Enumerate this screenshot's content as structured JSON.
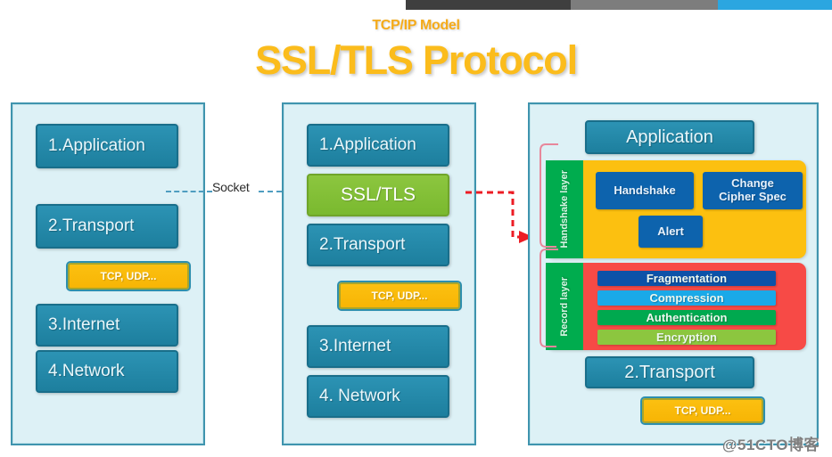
{
  "topbar": {
    "segments": [
      {
        "name": "dark",
        "color": "#3f3f3f"
      },
      {
        "name": "gray",
        "color": "#7d7d7d"
      },
      {
        "name": "blue",
        "color": "#2ba6e0"
      }
    ]
  },
  "header": {
    "subtitle": "TCP/IP Model",
    "title": "SSL/TLS Protocol",
    "title_color": "#fbbc1c",
    "subtitle_color": "#f5ab1a"
  },
  "connectors": {
    "socket_label": "Socket",
    "socket_line_color": "#4f9dc0",
    "red_arrow_color": "#ec1c24",
    "pink_bracket_color": "#e8879b"
  },
  "panels": {
    "left": {
      "name": "tcp-ip-model-stack",
      "layers": [
        {
          "label": "1.Application"
        },
        {
          "label": "2.Transport"
        },
        {
          "label": "3.Internet"
        },
        {
          "label": "4.Network"
        }
      ],
      "protocol_box": "TCP, UDP..."
    },
    "middle": {
      "name": "tcp-ip-with-ssl-stack",
      "layers": [
        {
          "label": "1.Application"
        },
        {
          "label": "2.Transport"
        },
        {
          "label": "3.Internet"
        },
        {
          "label": "4. Network"
        }
      ],
      "ssl_box": "SSL/TLS",
      "protocol_box": "TCP, UDP..."
    },
    "right": {
      "name": "ssl-tls-internal-architecture",
      "application_label": "Application",
      "handshake_layer": {
        "side_label": "Handshake layer",
        "side_label_color": "#00ac4e",
        "container_color": "#fcc010",
        "protocols": [
          {
            "label": "Handshake",
            "color": "#0d63ad"
          },
          {
            "label": "Change\nCipher Spec",
            "color": "#0d63ad"
          },
          {
            "label": "Alert",
            "color": "#0d63ad"
          }
        ],
        "protocol_handshake": "Handshake",
        "protocol_change_cipher_line1": "Change",
        "protocol_change_cipher_line2": "Cipher Spec",
        "protocol_alert": "Alert"
      },
      "record_layer": {
        "side_label": "Record layer",
        "side_label_color": "#00ac4e",
        "container_color": "#f74a46",
        "steps": [
          {
            "label": "Fragmentation",
            "color": "#0d52a8"
          },
          {
            "label": "Compression",
            "color": "#1aa9e8"
          },
          {
            "label": "Authentication",
            "color": "#00a94f"
          },
          {
            "label": "Encryption",
            "color": "#8cc63f"
          }
        ]
      },
      "transport_label": "2.Transport",
      "protocol_box": "TCP, UDP..."
    }
  },
  "watermark": "@51CTO博客"
}
